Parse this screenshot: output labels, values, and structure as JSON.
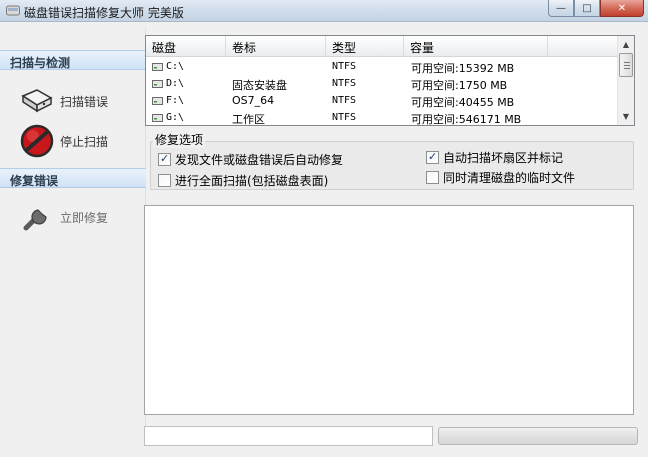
{
  "window": {
    "title": "磁盘错误扫描修复大师 完美版",
    "minimize_glyph": "—",
    "maximize_glyph": "□",
    "close_glyph": "✕"
  },
  "sidebar": {
    "scan_section": "扫描与检测",
    "scan_errors": "扫描错误",
    "stop_scan": "停止扫描",
    "repair_section": "修复错误",
    "repair_now": "立即修复"
  },
  "disk_list": {
    "columns": [
      "磁盘",
      "卷标",
      "类型",
      "容量"
    ],
    "rows": [
      {
        "drive": "C:\\",
        "label": "",
        "type": "NTFS",
        "capacity": "可用空间:15392 MB"
      },
      {
        "drive": "D:\\",
        "label": "固态安装盘",
        "type": "NTFS",
        "capacity": "可用空间:1750 MB"
      },
      {
        "drive": "F:\\",
        "label": "OS7_64",
        "type": "NTFS",
        "capacity": "可用空间:40455 MB"
      },
      {
        "drive": "G:\\",
        "label": "工作区",
        "type": "NTFS",
        "capacity": "可用空间:546171 MB"
      }
    ]
  },
  "options": {
    "title": "修复选项",
    "auto_repair": {
      "label": "发现文件或磁盘错误后自动修复",
      "checked": true
    },
    "full_scan": {
      "label": "进行全面扫描(包括磁盘表面)",
      "checked": false
    },
    "mark_bad_sectors": {
      "label": "自动扫描坏扇区并标记",
      "checked": true
    },
    "clean_temp": {
      "label": "同时清理磁盘的临时文件",
      "checked": false
    }
  },
  "log": {
    "text": ""
  },
  "status": {
    "text": "",
    "progress": 0
  },
  "colors": {
    "accent": "#c4d3e4",
    "header_blue": "#cfe2f5",
    "stop_red": "#c8171b"
  },
  "icons": {
    "app": "app-icon",
    "scan": "disk-drive-icon",
    "stop": "stop-icon",
    "repair": "wrench-icon",
    "drive": "drive-icon"
  }
}
